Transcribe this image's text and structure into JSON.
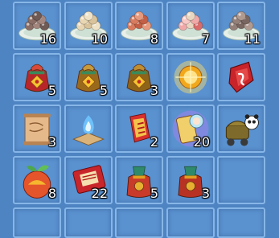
{
  "inventory": {
    "rows": [
      [
        {
          "item": "plate-of-dark-rice-balls",
          "count": "16"
        },
        {
          "item": "plate-of-pale-rice-balls",
          "count": "10"
        },
        {
          "item": "plate-of-red-rice-balls",
          "count": "8"
        },
        {
          "item": "plate-of-mixed-rice-balls",
          "count": "7"
        },
        {
          "item": "plate-of-dark-rice-balls-large",
          "count": "11"
        }
      ],
      [
        {
          "item": "red-lucky-pouch",
          "count": "5"
        },
        {
          "item": "golden-lucky-pouch",
          "count": "5"
        },
        {
          "item": "golden-lucky-pouch-small",
          "count": "3"
        },
        {
          "item": "glowing-gold-orb",
          "count": ""
        },
        {
          "item": "red-rune-stone",
          "count": ""
        }
      ],
      [
        {
          "item": "paper-scroll",
          "count": "3"
        },
        {
          "item": "blue-flame-cushion",
          "count": ""
        },
        {
          "item": "red-spirit-talisman",
          "count": "2"
        },
        {
          "item": "spirit-card",
          "count": "20"
        },
        {
          "item": "panda-treasure-cart",
          "count": ""
        }
      ],
      [
        {
          "item": "golden-peach-fruit",
          "count": "8"
        },
        {
          "item": "red-envelope",
          "count": "22"
        },
        {
          "item": "red-gift-sack",
          "count": "5"
        },
        {
          "item": "red-gift-sack-small",
          "count": "3"
        },
        {
          "item": "empty",
          "count": ""
        }
      ],
      [
        {
          "item": "empty",
          "count": ""
        },
        {
          "item": "empty",
          "count": ""
        },
        {
          "item": "empty",
          "count": ""
        },
        {
          "item": "empty",
          "count": ""
        },
        {
          "item": "empty",
          "count": ""
        }
      ]
    ]
  }
}
